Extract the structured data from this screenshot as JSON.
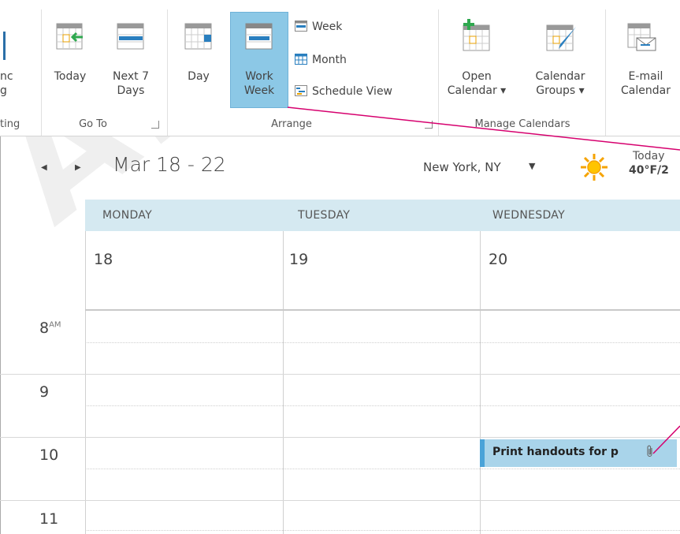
{
  "ribbon": {
    "partial_left_line1": "nc",
    "partial_left_line2": "g",
    "partial_left_group": "ting",
    "today": "Today",
    "next7_line1": "Next 7",
    "next7_line2": "Days",
    "goto_group": "Go To",
    "day": "Day",
    "work_week_line1": "Work",
    "work_week_line2": "Week",
    "week": "Week",
    "month": "Month",
    "schedule_view": "Schedule View",
    "arrange_group": "Arrange",
    "open_calendar_line1": "Open",
    "open_calendar_line2": "Calendar ▾",
    "calendar_groups_line1": "Calendar",
    "calendar_groups_line2": "Groups ▾",
    "manage_group": "Manage Calendars",
    "email_calendar_line1": "E-mail",
    "email_calendar_line2": "Calendar"
  },
  "calendar": {
    "date_range": "Mar 18 - 22",
    "location": "New York, NY",
    "weather_label": "Today",
    "weather_temp": "40°F/2",
    "days": [
      {
        "name": "MONDAY",
        "num": "18"
      },
      {
        "name": "TUESDAY",
        "num": "19"
      },
      {
        "name": "WEDNESDAY",
        "num": "20"
      }
    ],
    "hours": [
      {
        "h": "8",
        "suffix": "AM"
      },
      {
        "h": "9",
        "suffix": ""
      },
      {
        "h": "10",
        "suffix": ""
      },
      {
        "h": "11",
        "suffix": ""
      }
    ],
    "appointment": "Print handouts for p"
  },
  "watermark": "ALUE",
  "colors": {
    "selected_button": "#8cc8e6",
    "day_header": "#d5e9f1",
    "appointment": "#a9d4ea",
    "appointment_bar": "#4aa3d8",
    "callout_line": "#d6006e"
  }
}
